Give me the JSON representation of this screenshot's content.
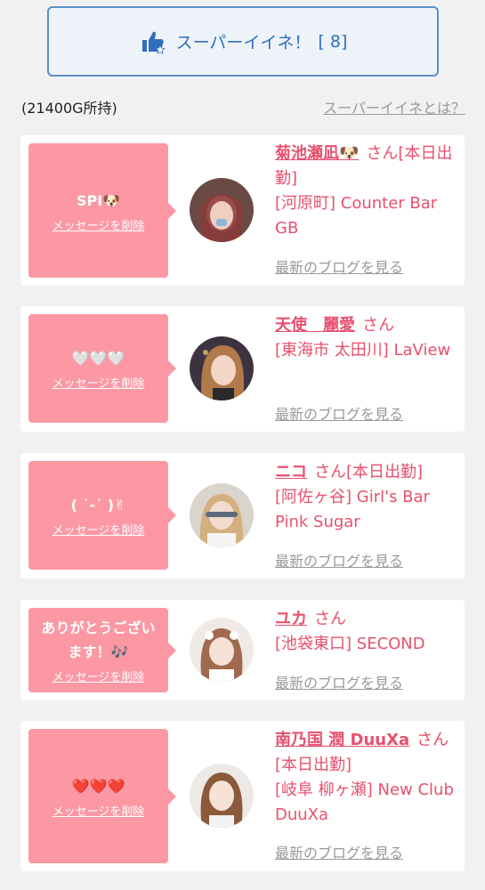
{
  "header": {
    "super_like_label": "スーパーイイネ！",
    "super_like_count": "[ 8]",
    "icon": "thumbs-up-star-icon"
  },
  "points_label": "(21400G所持)",
  "about_link": "スーパーイイネとは？",
  "delete_label": "メッセージを削除",
  "blog_label": "最新のブログを見る",
  "colors": {
    "accent_pink": "#fc97a4",
    "name_pink": "#e8506e",
    "button_blue": "#2f6fbd"
  },
  "cards": [
    {
      "message": "SPI🐶",
      "name": "菊池瀬凪🐶",
      "suffix": "さん[本日出勤]",
      "shop": "[河原町] Counter Bar GB"
    },
    {
      "message": "🤍🤍🤍",
      "name": "天使　麗愛",
      "suffix": "さん",
      "shop": "[東海市 太田川] LaView"
    },
    {
      "message": "( ˙-˙ )✌",
      "name": "ニコ",
      "suffix": "さん[本日出勤]",
      "shop": "[阿佐ヶ谷] Girl's Bar Pink Sugar"
    },
    {
      "message": "ありがとうございます！🎶",
      "name": "ユカ",
      "suffix": "さん",
      "shop": "[池袋東口] SECOND"
    },
    {
      "message": "❤️❤️❤️",
      "name": "南乃国 潤 DuuXa",
      "suffix": "さん[本日出勤]",
      "shop": "[岐阜 柳ヶ瀬] New Club DuuXa"
    }
  ]
}
